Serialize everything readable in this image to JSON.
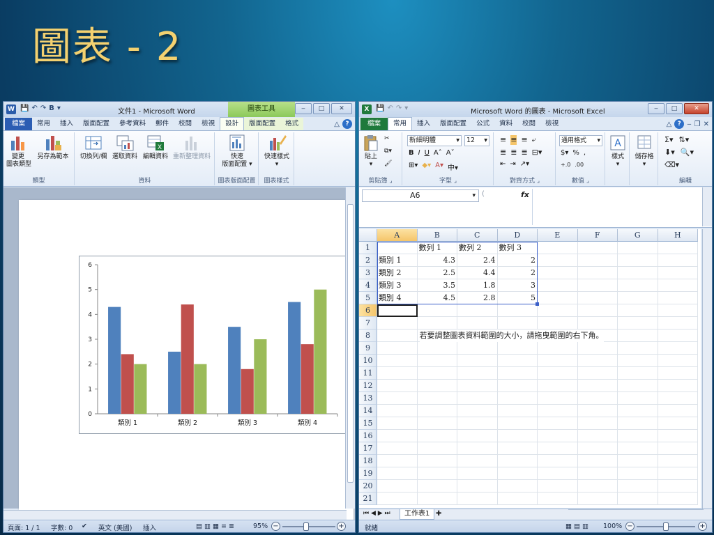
{
  "slide": {
    "title": "圖表 - 2"
  },
  "word": {
    "title": "文件1 - Microsoft Word",
    "context_tab_title": "圖表工具",
    "tabs": [
      "檔案",
      "常用",
      "插入",
      "版面配置",
      "參考資料",
      "郵件",
      "校閱",
      "檢視",
      "設計",
      "版面配置",
      "格式"
    ],
    "ribbon": {
      "groups": [
        {
          "label": "類型",
          "buttons": [
            "變更\n圖表類型",
            "另存為範本"
          ]
        },
        {
          "label": "資料",
          "buttons": [
            "切換列/欄",
            "選取資料",
            "編輯資料",
            "重新整理資料"
          ]
        },
        {
          "label": "圖表版面配置",
          "buttons": [
            "快速\n版面配置"
          ]
        },
        {
          "label": "圖表樣式",
          "buttons": [
            "快速樣式"
          ]
        }
      ],
      "btn_change_type_1": "變更",
      "btn_change_type_2": "圖表類型",
      "btn_save_template": "另存為範本",
      "btn_switch": "切換列/欄",
      "btn_select": "選取資料",
      "btn_edit": "編輯資料",
      "btn_refresh": "重新整理資料",
      "btn_quick_layout_1": "快速",
      "btn_quick_layout_2": "版面配置",
      "btn_quick_style": "快速樣式",
      "group_type": "類型",
      "group_data": "資料",
      "group_layout": "圖表版面配置",
      "group_style": "圖表樣式"
    },
    "status": {
      "page": "頁面: 1 / 1",
      "words": "字數: 0",
      "lang": "英文 (美國)",
      "mode": "插入",
      "zoom": "95%"
    }
  },
  "chart_data": {
    "type": "bar",
    "categories": [
      "類別 1",
      "類別 2",
      "類別 3",
      "類別 4"
    ],
    "series": [
      {
        "name": "數列 1",
        "values": [
          4.3,
          2.5,
          3.5,
          4.5
        ],
        "color": "#4f81bd"
      },
      {
        "name": "數列 2",
        "values": [
          2.4,
          4.4,
          1.8,
          2.8
        ],
        "color": "#c0504d"
      },
      {
        "name": "數列 3",
        "values": [
          2,
          2,
          3,
          5
        ],
        "color": "#9bbb59"
      }
    ],
    "ylim": [
      0,
      6
    ],
    "yticks": [
      "0",
      "1",
      "2",
      "3",
      "4",
      "5",
      "6"
    ],
    "grid": false,
    "legend": "none"
  },
  "excel": {
    "title": "Microsoft Word 的圖表 - Microsoft Excel",
    "tabs": [
      "檔案",
      "常用",
      "插入",
      "版面配置",
      "公式",
      "資料",
      "校閱",
      "檢視"
    ],
    "ribbon": {
      "paste": "貼上",
      "font_name": "新細明體",
      "font_size": "12",
      "number_format": "通用格式",
      "style": "樣式",
      "cells": "儲存格",
      "g_clipboard": "剪貼簿",
      "g_font": "字型",
      "g_align": "對齊方式",
      "g_number": "數值",
      "g_edit": "編輯"
    },
    "namebox": "A6",
    "fx": "fx",
    "columns": [
      "A",
      "B",
      "C",
      "D",
      "E",
      "F",
      "G",
      "H"
    ],
    "rows": [
      "1",
      "2",
      "3",
      "4",
      "5",
      "6",
      "7",
      "8",
      "9",
      "10",
      "11",
      "12",
      "13",
      "14",
      "15",
      "16",
      "17",
      "18",
      "19",
      "20",
      "21"
    ],
    "data": {
      "B1": "數列 1",
      "C1": "數列 2",
      "D1": "數列 3",
      "A2": "類別 1",
      "B2": "4.3",
      "C2": "2.4",
      "D2": "2",
      "A3": "類別 2",
      "B3": "2.5",
      "C3": "4.4",
      "D3": "2",
      "A4": "類別 3",
      "B4": "3.5",
      "C4": "1.8",
      "D4": "3",
      "A5": "類別 4",
      "B5": "4.5",
      "C5": "2.8",
      "D5": "5"
    },
    "note": "若要調整圖表資料範圍的大小，請拖曳範圍的右下角。",
    "sheet_tab": "工作表1",
    "status": {
      "ready": "就緒",
      "zoom": "100%"
    }
  }
}
